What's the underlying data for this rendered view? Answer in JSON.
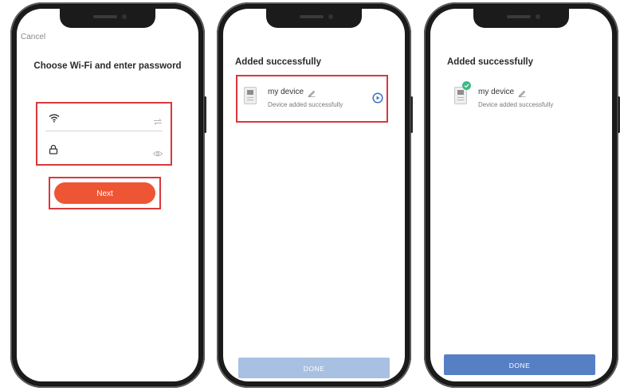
{
  "screens": [
    {
      "cancel_label": "Cancel",
      "title": "Choose Wi-Fi and enter password",
      "ssid_field": {
        "value": "",
        "leading_icon": "wifi-icon",
        "trailing_icon": "swap-icon"
      },
      "password_field": {
        "value": "",
        "leading_icon": "lock-icon",
        "trailing_icon": "eye-icon"
      },
      "next_label": "Next"
    },
    {
      "title": "Added successfully",
      "device": {
        "name": "my device",
        "status": "Device added successfully",
        "icon": "device-icon",
        "action_icon": "play-circle-icon"
      },
      "done_label": "DONE",
      "done_state": "disabled"
    },
    {
      "title": "Added successfully",
      "device": {
        "name": "my device",
        "status": "Device added successfully",
        "icon": "device-icon",
        "badge_icon": "check-badge-icon"
      },
      "done_label": "DONE",
      "done_state": "enabled"
    }
  ],
  "colors": {
    "highlight_outline": "#d9383c",
    "next_button": "#ee5535",
    "done_disabled": "#a8c1e3",
    "done_enabled": "#5780c4",
    "success_badge": "#3fba84",
    "play_icon": "#3a6fc4"
  }
}
